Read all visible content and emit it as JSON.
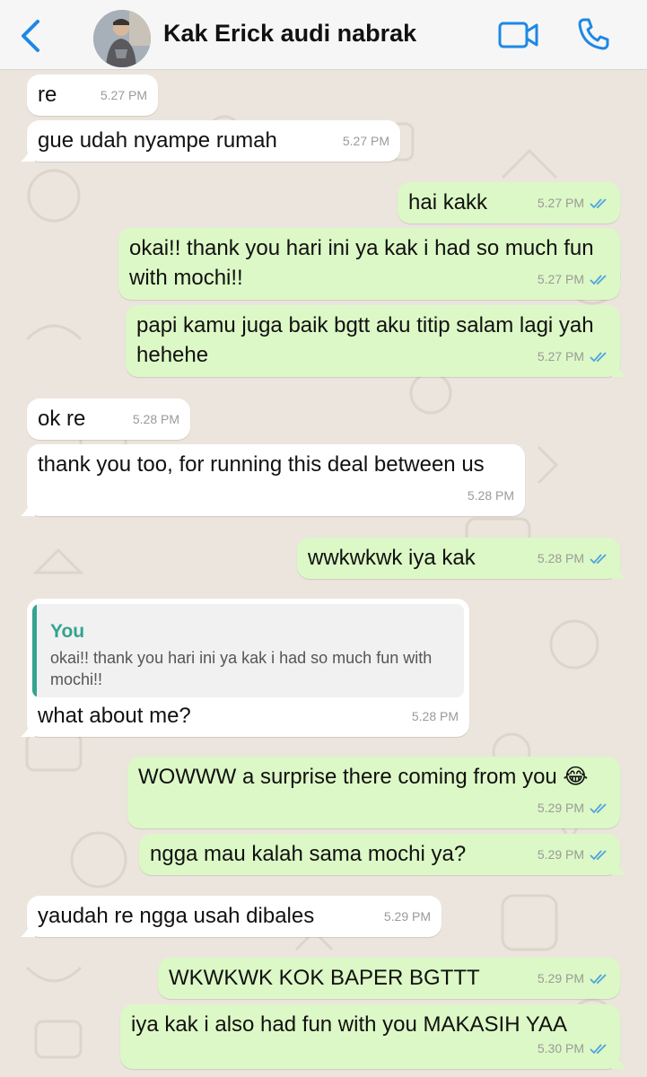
{
  "header": {
    "contact_name": "Kak Erick audi nabrak",
    "back_icon": "chevron-left-icon",
    "video_icon": "video-camera-icon",
    "call_icon": "phone-icon",
    "accent_color": "#1e88e5"
  },
  "colors": {
    "incoming_bubble": "#ffffff",
    "outgoing_bubble": "#dcf8c6",
    "read_ticks": "#4fa3e0",
    "quote_accent": "#34a38f",
    "wallpaper": "#ece5dd"
  },
  "messages": [
    {
      "text": "re",
      "time": "5.27 PM",
      "direction": "in"
    },
    {
      "text": "gue udah nyampe rumah",
      "time": "5.27 PM",
      "direction": "in"
    },
    {
      "text": "hai kakk",
      "time": "5.27 PM",
      "direction": "out",
      "status": "read"
    },
    {
      "text": "okai!! thank you hari ini ya kak i had so much fun with mochi!!",
      "time": "5.27 PM",
      "direction": "out",
      "status": "read"
    },
    {
      "text": "papi kamu juga baik bgtt aku titip salam lagi yah hehehe",
      "time": "5.27 PM",
      "direction": "out",
      "status": "read"
    },
    {
      "text": "ok re",
      "time": "5.28 PM",
      "direction": "in"
    },
    {
      "text": "thank you too, for running this deal between us",
      "time": "5.28 PM",
      "direction": "in"
    },
    {
      "text": "wwkwkwk iya kak",
      "time": "5.28 PM",
      "direction": "out",
      "status": "read"
    },
    {
      "text": "what about me?",
      "time": "5.28 PM",
      "direction": "in",
      "reply_to": {
        "author": "You",
        "text": "okai!! thank you hari ini ya kak i had so much fun with mochi!!"
      }
    },
    {
      "text": "WOWWW a surprise there coming from you 😂",
      "time": "5.29 PM",
      "direction": "out",
      "status": "read"
    },
    {
      "text": "ngga mau kalah sama mochi ya?",
      "time": "5.29 PM",
      "direction": "out",
      "status": "read"
    },
    {
      "text": "yaudah re ngga usah dibales",
      "time": "5.29 PM",
      "direction": "in"
    },
    {
      "text": "WKWKWK KOK BAPER BGTTT",
      "time": "5.29 PM",
      "direction": "out",
      "status": "read"
    },
    {
      "text": "iya kak i also had fun with you MAKASIH YAA",
      "time": "5.30 PM",
      "direction": "out",
      "status": "read"
    }
  ]
}
